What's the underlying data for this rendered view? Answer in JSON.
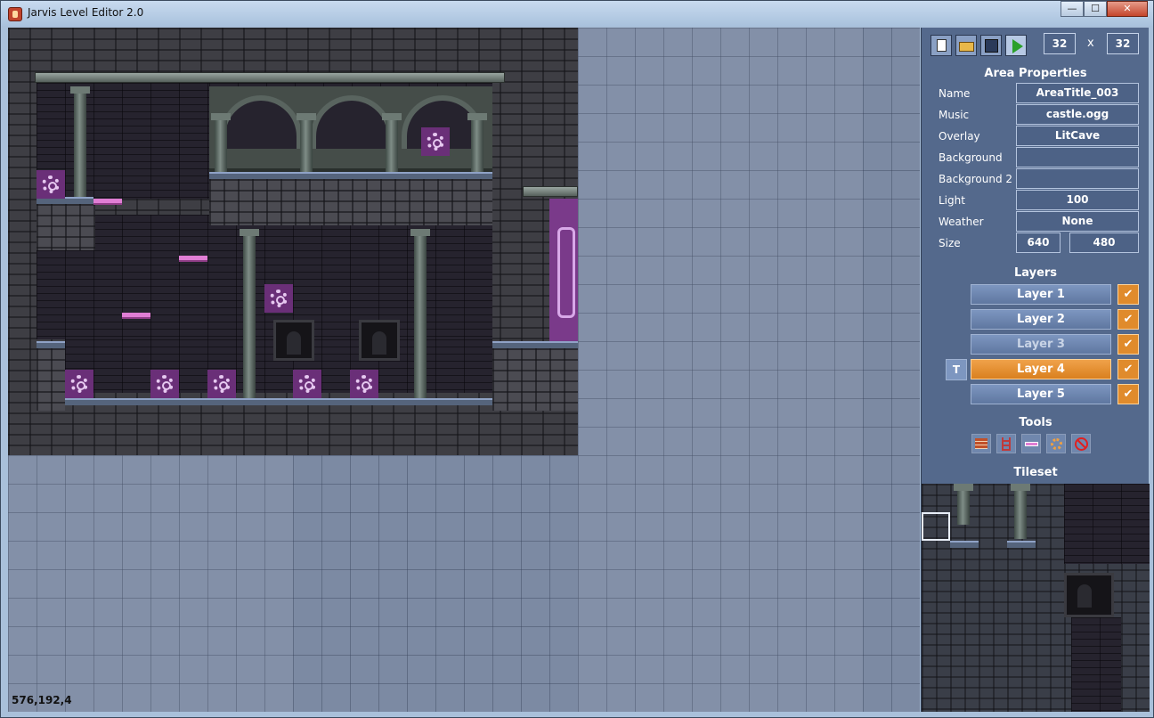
{
  "window": {
    "title": "Jarvis Level Editor 2.0",
    "minimize": "—",
    "maximize": "☐",
    "close": "✕"
  },
  "canvas": {
    "cursor_readout": "576,192,4"
  },
  "toolbar": {
    "new": "new-file-icon",
    "open": "open-folder-icon",
    "save": "save-icon",
    "play": "play-icon",
    "tile_width": "32",
    "tile_height": "32",
    "by": "x"
  },
  "area": {
    "heading": "Area Properties",
    "rows": [
      {
        "label": "Name",
        "value": "AreaTitle_003"
      },
      {
        "label": "Music",
        "value": "castle.ogg"
      },
      {
        "label": "Overlay",
        "value": "LitCave"
      },
      {
        "label": "Background",
        "value": ""
      },
      {
        "label": "Background 2",
        "value": ""
      },
      {
        "label": "Light",
        "value": "100"
      },
      {
        "label": "Weather",
        "value": "None"
      }
    ],
    "size_label": "Size",
    "size_w": "640",
    "size_by": "x",
    "size_h": "480"
  },
  "layers": {
    "heading": "Layers",
    "items": [
      {
        "label": "Layer 1",
        "visible": "✔"
      },
      {
        "label": "Layer 2",
        "visible": "✔"
      },
      {
        "label": "Layer 3",
        "visible": "✔"
      },
      {
        "label": "Layer 4",
        "visible": "✔"
      },
      {
        "label": "Layer 5",
        "visible": "✔"
      }
    ],
    "selected": "Layer 4",
    "tile_toggle": "T"
  },
  "tools": {
    "heading": "Tools",
    "items": [
      "brick-tile-icon",
      "ladder-icon",
      "platform-icon",
      "gear-entity-icon",
      "erase-icon"
    ]
  },
  "tileset": {
    "heading": "Tileset"
  },
  "colors": {
    "panel": "#54698c",
    "accent": "#e08b2c",
    "layer_button": "#6f87b0"
  }
}
